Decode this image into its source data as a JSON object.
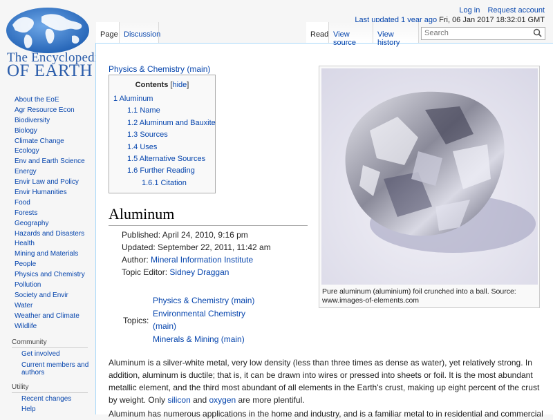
{
  "logo": {
    "line1": "The Encyclopedia",
    "line2": "OF EARTH"
  },
  "personal": {
    "login": "Log in",
    "request": "Request account",
    "updated_label": "Last updated",
    "updated_ago": "1 year ago",
    "updated_date": "Fri, 06 Jan 2017 18:32:01 GMT"
  },
  "tabs": {
    "page": "Page",
    "discussion": "Discussion",
    "read": "Read",
    "view_source": "View source",
    "view_history": "View history"
  },
  "search": {
    "placeholder": "Search"
  },
  "sidebar": {
    "items": [
      "About the EoE",
      "Agr Resource Econ",
      "Biodiversity",
      "Biology",
      "Climate Change",
      "Ecology",
      "Env and Earth Science",
      "Energy",
      "Envir Law and Policy",
      "Envir Humanities",
      "Food",
      "Forests",
      "Geography",
      "Hazards and Disasters",
      "Health",
      "Mining and Materials",
      "People",
      "Physics and Chemistry",
      "Pollution",
      "Society and Envir",
      "Water",
      "Weather and Climate",
      "Wildlife"
    ],
    "community_heading": "Community",
    "community": [
      "Get involved",
      "Current members and authors"
    ],
    "utility_heading": "Utility",
    "utility": [
      "Recent changes",
      "Help"
    ]
  },
  "category_link": "Physics & Chemistry (main)",
  "toc": {
    "title": "Contents",
    "hide": "hide",
    "items": [
      "1 Aluminum",
      "1.1 Name",
      "1.2 Aluminum and Bauxite",
      "1.3 Sources",
      "1.4 Uses",
      "1.5 Alternative Sources",
      "1.6 Further Reading",
      "1.6.1 Citation"
    ]
  },
  "heading": "Aluminum",
  "meta": {
    "published": "Published: April 24, 2010, 9:16 pm",
    "updated": "Updated: September 22, 2011, 11:42 am",
    "author_label": "Author:",
    "author": "Mineral Information Institute",
    "editor_label": "Topic Editor:",
    "editor": "Sidney Draggan",
    "topics_label": "Topics:",
    "topics": [
      "Physics & Chemistry (main)",
      "Environmental Chemistry (main)",
      "Minerals & Mining (main)"
    ]
  },
  "figure": {
    "caption": "Pure aluminum (aluminium) foil crunched into a ball. Source: www.images-of-elements.com"
  },
  "body": {
    "p1_a": "Aluminum is a silver-white metal, very low density (less than three times as dense as water), yet relatively strong. In addition, aluminum is ductile; that is, it can be drawn into wires or pressed into sheets or foil. It is the most abundant metallic element, and the third most abundant of all elements in the Earth's crust, making up eight percent of the crust by weight. Only",
    "p1_link1": "silicon",
    "p1_b": "and",
    "p1_link2": "oxygen",
    "p1_c": "are more plentiful.",
    "p2": "Aluminum has numerous applications in the home and industry, and is a familiar metal to in residential and commercial usage."
  },
  "colors": {
    "link": "#0645ad",
    "logo": "#2a5caa",
    "tab_border": "#a7d7f9"
  }
}
